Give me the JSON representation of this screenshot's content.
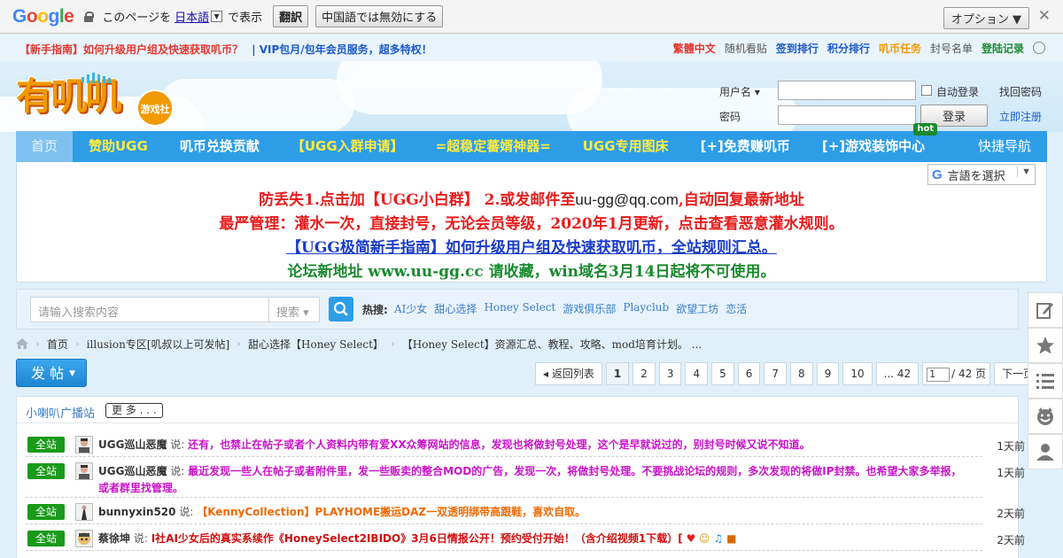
{
  "translate_bar": {
    "logo": [
      "G",
      "o",
      "o",
      "g",
      "l",
      "e"
    ],
    "prefix": "このページを",
    "language": "日本語",
    "suffix": "で表示",
    "translate_button": "翻訳",
    "disable_button": "中国語では無効にする",
    "options_button": "オプション ▼",
    "close": "✕"
  },
  "topbar": {
    "left_notice": "【新手指南】如何升级用户组及快速获取叽币？",
    "left_vip": "| VIP包月/包年会员服务，超多特权！",
    "links": [
      {
        "label": "繁體中文",
        "style": "red"
      },
      {
        "label": "随机看贴",
        "style": "gray"
      },
      {
        "label": "签到排行",
        "style": "blue"
      },
      {
        "label": "积分排行",
        "style": "blue"
      },
      {
        "label": "叽币任务",
        "style": "orange"
      },
      {
        "label": "封号名单",
        "style": "gray"
      },
      {
        "label": "登陆记录",
        "style": "green"
      }
    ]
  },
  "header": {
    "logo_text": "有叽叽",
    "logo_badge": "游戏社",
    "login": {
      "username_label": "用户名 ▾",
      "password_label": "密码",
      "auto_login": "自动登录",
      "forgot": "找回密码",
      "login_button": "登录",
      "register": "立即注册"
    }
  },
  "nav": {
    "items": [
      {
        "label": "首页",
        "style": "home"
      },
      {
        "label": "赞助UGG",
        "style": "yellow"
      },
      {
        "label": "叽币兑换贡献",
        "style": "white"
      },
      {
        "label": "【UGG入群申请】",
        "style": "yellow"
      },
      {
        "label": "=超稳定蕃婿神器=",
        "style": "yellow"
      },
      {
        "label": "UGG专用图床",
        "style": "yellow"
      },
      {
        "label": "[+]免费赚叽币",
        "style": "white"
      },
      {
        "label": "[+]游戏装饰中心",
        "style": "white"
      }
    ],
    "hot_badge": "hot",
    "quick_nav": "快捷导航"
  },
  "notice": {
    "line1_a": "防丢失1.点击加【UGG小白群】 2.或发邮件至",
    "line1_email": "uu-gg@qq.com",
    "line1_b": ",自动回复最新地址",
    "line2": "最严管理：灌水一次，直接封号，无论会员等级，2020年1月更新，点击查看恶意灌水规则。",
    "line3": "【UGG极简新手指南】如何升级用户组及快速获取叽币，全站规则汇总。",
    "line4": "论坛新地址 www.uu-gg.cc 请收藏，win域名3月14日起将不可使用。",
    "lang_select": "言語を選択",
    "lang_select_g": "G",
    "lang_caret": "▼"
  },
  "search": {
    "placeholder": "请输入搜索内容",
    "scope": "搜索 ▾",
    "hot_label": "热搜:",
    "hot_links": [
      "AI少女",
      "甜心选择",
      "Honey Select",
      "游戏俱乐部",
      "Playclub",
      "欲望工坊",
      "恋活"
    ]
  },
  "breadcrumb": {
    "items": [
      "首页",
      "illusion专区[叽叔以上可发帖]",
      "甜心选择【Honey Select】",
      "【Honey Select】资源汇总、教程、攻略、mod培育计划。 ..."
    ],
    "sep": "›"
  },
  "toolbar": {
    "post_label": "发 帖",
    "post_arrow": "▼",
    "back_label": "◂ 返回列表",
    "pages": [
      "1",
      "2",
      "3",
      "4",
      "5",
      "6",
      "7",
      "8",
      "9",
      "10"
    ],
    "last": "... 42",
    "page_input": "1",
    "page_total": "/ 42 页",
    "next": "下一页"
  },
  "broadcast": {
    "title": "小喇叭广播站",
    "more": "更 多 . . .",
    "rows": [
      {
        "tag": "全站",
        "user": "UGG巡山恶魔",
        "say": "说:",
        "msg": "还有，也禁止在帖子或者个人资料内带有爱XX众筹网站的信息，发现也将做封号处理，这个是早就说过的，别封号时候又说不知道。",
        "style": "pink",
        "time": "1天前"
      },
      {
        "tag": "全站",
        "user": "UGG巡山恶魔",
        "say": "说:",
        "msg": "最近发现一些人在帖子或者附件里，发一些贩卖的整合MOD的广告，发现一次，将做封号处理。不要挑战论坛的规则，多次发现的将做IP封禁。也希望大家多举报，或者群里找管理。",
        "style": "pink",
        "time": "1天前"
      },
      {
        "tag": "全站",
        "user": "bunnyxin520",
        "say": "说:",
        "msg": "【KennyCollection】PLAYHOME搬运DAZ一双透明绑带高跟鞋，喜欢自取。",
        "style": "orange",
        "time": "2天前"
      },
      {
        "tag": "全站",
        "user": "蔡徐坤",
        "say": "说:",
        "msg": "I社AI少女后的真实系续作《HoneySelect2IBIDO》3月6日情报公开！预约受付开始！（含介绍视频1下载）[",
        "style": "red",
        "time": "2天前"
      }
    ]
  },
  "side_tools": [
    "edit-icon",
    "star-icon",
    "list-icon",
    "emoji-icon",
    "user-icon"
  ]
}
